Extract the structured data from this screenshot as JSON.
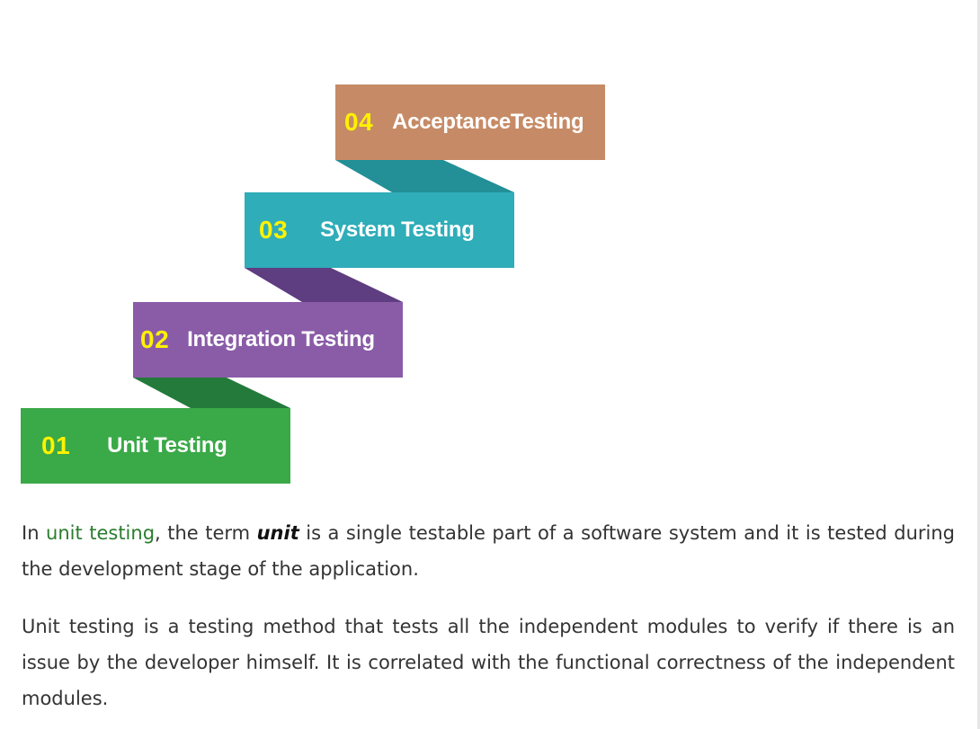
{
  "diagram": {
    "steps": [
      {
        "num": "04",
        "label": "AcceptanceTesting",
        "color": "#c68b66"
      },
      {
        "num": "03",
        "label": "System Testing",
        "color": "#2fadb9"
      },
      {
        "num": "02",
        "label": "Integration Testing",
        "color": "#8a5ca8"
      },
      {
        "num": "01",
        "label": "Unit Testing",
        "color": "#3aa948"
      }
    ],
    "connector_colors": [
      "#238f97",
      "#5e3d80",
      "#237a3b"
    ],
    "number_color": "#fff200"
  },
  "article": {
    "p1": {
      "intro": "In ",
      "link": "unit testing",
      "after_link": ", the term ",
      "term": "unit",
      "rest": " is a single testable part of a software system and it is tested during the development stage of the application."
    },
    "p2": "Unit testing is a testing method that tests all the independent modules to verify if there is an issue by the developer himself. It is correlated with the functional correctness of the independent modules.",
    "link_color": "#2a7d2e"
  }
}
